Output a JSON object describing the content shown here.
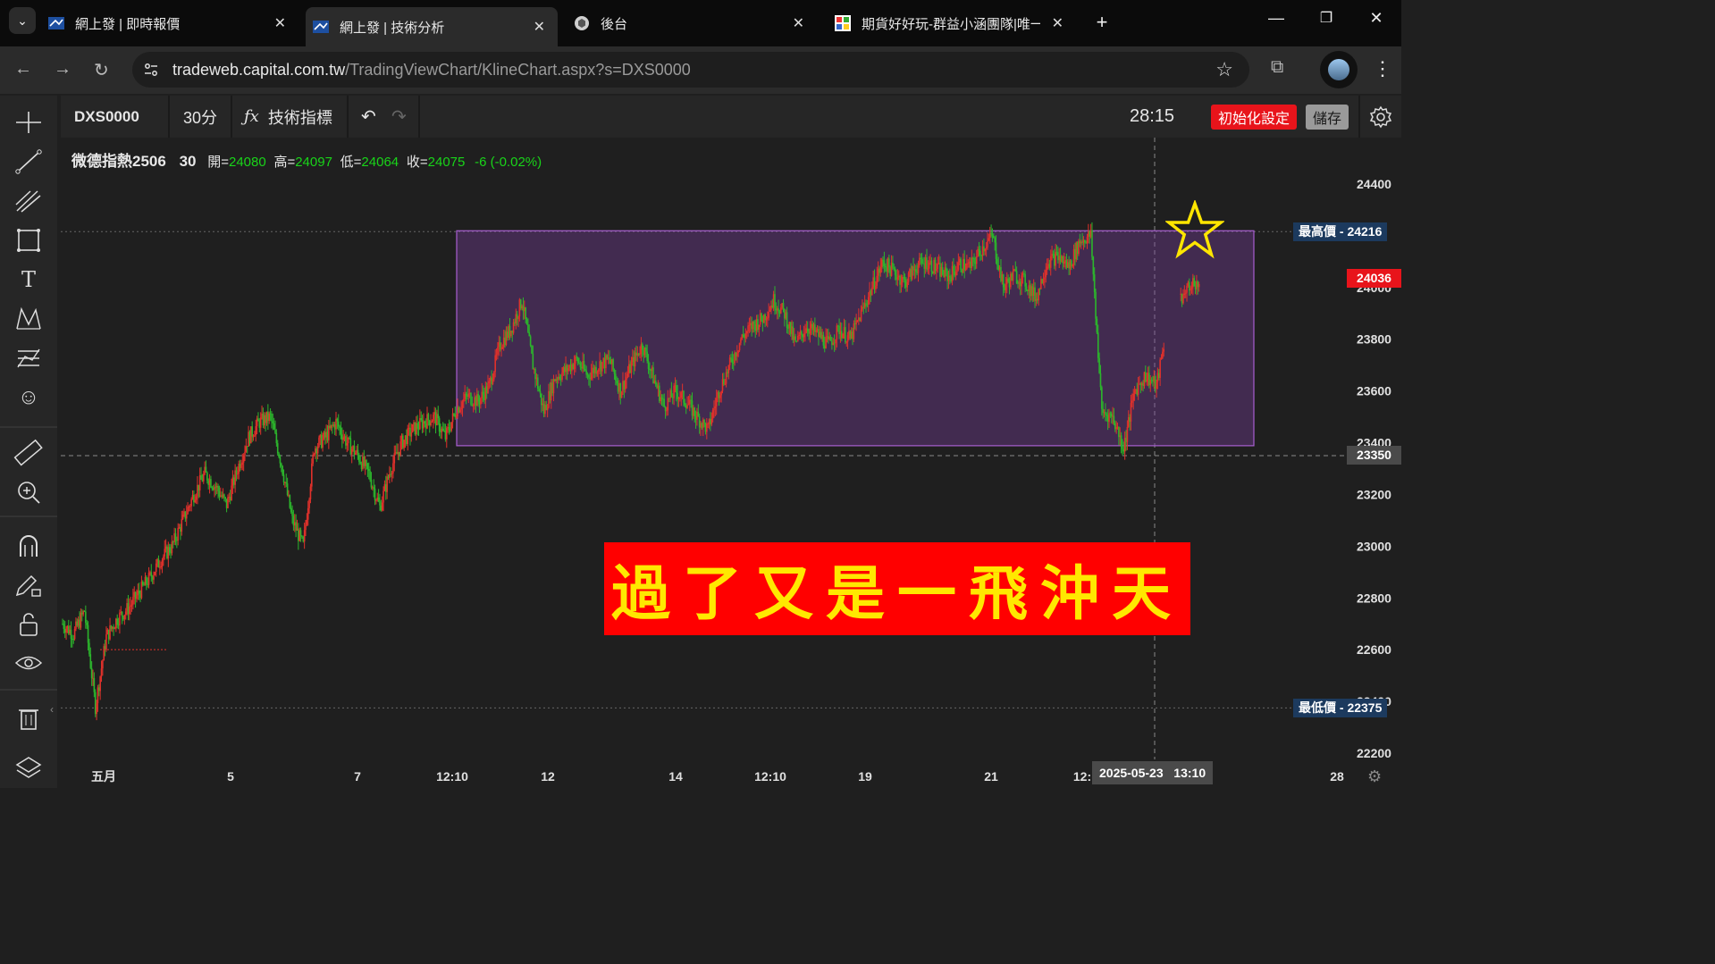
{
  "browser": {
    "tabs": [
      {
        "label": "網上發 | 即時報價",
        "active": false
      },
      {
        "label": "網上發 | 技術分析",
        "active": true
      },
      {
        "label": "後台",
        "active": false
      },
      {
        "label": "期貨好好玩-群益小涵團隊|唯一",
        "active": false
      }
    ],
    "url_host": "tradeweb.capital.com.tw",
    "url_path": "/TradingViewChart/KlineChart.aspx?s=DXS0000"
  },
  "toolbar": {
    "symbol": "DXS0000",
    "interval": "30分",
    "indicators_label": "技術指標",
    "countdown": "28:15",
    "reset_label": "初始化設定",
    "save_label": "儲存"
  },
  "legend": {
    "name": "微德指熱2506",
    "interval": "30",
    "open_label": "開=",
    "open": "24080",
    "high_label": "高=",
    "high": "24097",
    "low_label": "低=",
    "low": "24064",
    "close_label": "收=",
    "close": "24075",
    "change": "-6 (-0.02%)"
  },
  "annotation": {
    "banner_text": "過了又是一飛沖天",
    "star_color": "#ffe600",
    "box_color": "#7b3fa0"
  },
  "chart_data": {
    "type": "candlestick",
    "ylim": [
      22150,
      24470
    ],
    "y_ticks": [
      24400,
      24000,
      23800,
      23600,
      23400,
      23200,
      23000,
      22800,
      22600,
      22400,
      22200
    ],
    "x_ticks": [
      "五月",
      "5",
      "7",
      "12:10",
      "12",
      "14",
      "12:10",
      "19",
      "21",
      "12:",
      "28"
    ],
    "crosshair_date": "2025-05-23",
    "crosshair_time": "13:10",
    "crosshair_price": "23350",
    "last_price": "24036",
    "high_label": "最高價",
    "high_value": "24216",
    "low_label": "最低價",
    "low_value": "22375",
    "up_color": "#e0312b",
    "down_color": "#2cb52c",
    "close_path": [
      22700,
      22660,
      22750,
      22380,
      22650,
      22720,
      22760,
      22820,
      22880,
      22950,
      23000,
      23100,
      23200,
      23280,
      23230,
      23160,
      23300,
      23420,
      23480,
      23500,
      23320,
      23100,
      23000,
      23380,
      23420,
      23480,
      23400,
      23350,
      23280,
      23150,
      23300,
      23400,
      23450,
      23480,
      23500,
      23420,
      23530,
      23580,
      23560,
      23620,
      23780,
      23840,
      23950,
      23700,
      23520,
      23650,
      23680,
      23720,
      23660,
      23700,
      23720,
      23600,
      23700,
      23780,
      23650,
      23540,
      23600,
      23560,
      23500,
      23450,
      23600,
      23700,
      23800,
      23850,
      23880,
      23950,
      23900,
      23780,
      23850,
      23820,
      23780,
      23840,
      23800,
      23900,
      24000,
      24100,
      24060,
      24020,
      24080,
      24100,
      24070,
      24040,
      24090,
      24080,
      24150,
      24200,
      24000,
      24050,
      24020,
      23960,
      24100,
      24120,
      24080,
      24180,
      24200,
      23520,
      23500,
      23380,
      23600,
      23660,
      23620,
      23850,
      23950,
      24000,
      24036
    ]
  }
}
